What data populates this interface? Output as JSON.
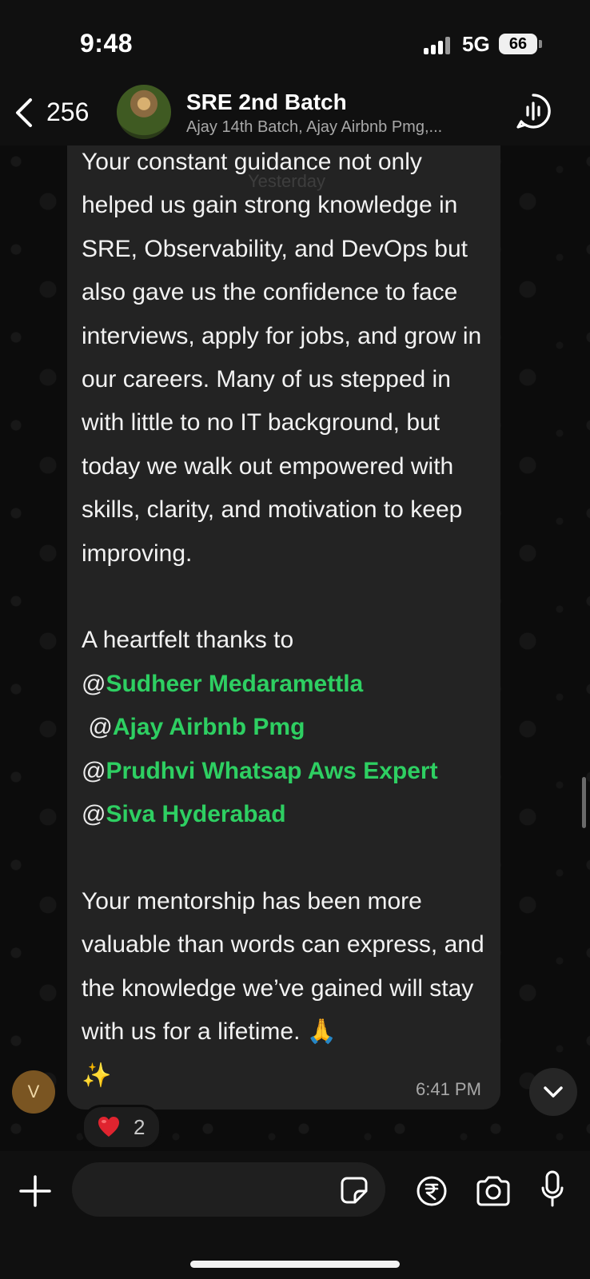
{
  "status_bar": {
    "time": "9:48",
    "network": "5G",
    "battery": "66"
  },
  "header": {
    "back_count": "256",
    "title": "SRE 2nd Batch",
    "subtitle": "Ajay 14th Batch, Ajay Airbnb Pmg,..."
  },
  "chat": {
    "date_chip": "Yesterday",
    "message": {
      "para1": "Your constant guidance not only helped us gain strong knowledge in SRE, Observability, and DevOps but also gave us the confidence to face interviews, apply for jobs, and grow in our careers. Many of us stepped in with little to no IT background, but today we walk out empowered with skills, clarity, and motivation to keep improving.",
      "thanks_intro": "A heartfelt thanks to",
      "mentions": [
        "Sudheer Medaramettla",
        "Ajay Airbnb Pmg",
        "Prudhvi Whatsap Aws Expert",
        "Siva Hyderabad"
      ],
      "para3": "Your mentorship has been more valuable than words can express, and the knowledge we’ve gained will stay with us for a lifetime. 🙏",
      "sparkle": "✨",
      "time": "6:41 PM"
    },
    "sender_initial": "V",
    "reaction": {
      "emoji": "heart",
      "count": "2"
    }
  },
  "icons": {
    "back": "chevron-left-icon",
    "call": "group-call-icon",
    "scroll": "chevron-down-icon",
    "plus": "plus-icon",
    "sticker": "sticker-icon",
    "payment": "rupee-icon",
    "camera": "camera-icon",
    "mic": "microphone-icon"
  },
  "colors": {
    "mention": "#2ecf62",
    "bubble": "#232323",
    "background": "#0c0c0c"
  }
}
